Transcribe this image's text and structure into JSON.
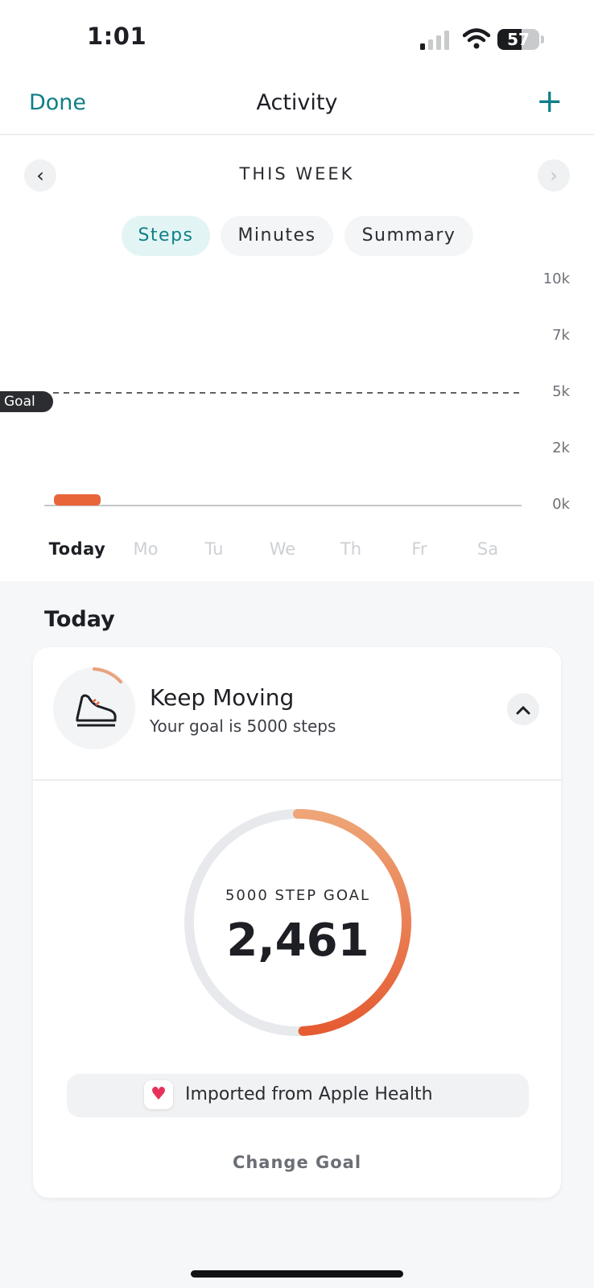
{
  "status_bar": {
    "time": "1:01",
    "battery_level": "57",
    "battery_fraction": 0.57
  },
  "nav": {
    "done_label": "Done",
    "title": "Activity",
    "add_icon": "plus-icon",
    "accent_color": "#0e7f87"
  },
  "week": {
    "label": "THIS WEEK",
    "prev_icon": "chevron-left-icon",
    "next_icon": "chevron-right-icon"
  },
  "tabs": [
    {
      "label": "Steps",
      "active": true
    },
    {
      "label": "Minutes",
      "active": false
    },
    {
      "label": "Summary",
      "active": false
    }
  ],
  "chart_data": {
    "type": "bar",
    "categories": [
      "Today",
      "Mo",
      "Tu",
      "We",
      "Th",
      "Fr",
      "Sa"
    ],
    "values": [
      2461,
      0,
      0,
      0,
      0,
      0,
      0
    ],
    "y_ticks": [
      "10k",
      "7k",
      "5k",
      "2k",
      "0k"
    ],
    "ylim": [
      0,
      10000
    ],
    "goal_line": {
      "label": "Goal",
      "value": 5000
    },
    "bar_color": "#e8653a",
    "grid": false
  },
  "today": {
    "heading": "Today",
    "card": {
      "icon": "shoe-icon",
      "title": "Keep Moving",
      "subtitle": "Your goal is 5000 steps",
      "collapse_icon": "chevron-up-icon",
      "ring_label": "5000 STEP GOAL",
      "ring_value": "2,461",
      "progress_fraction": 0.4922,
      "import_icon": "heart-icon",
      "import_text": "Imported from Apple Health",
      "change_goal_label": "Change Goal"
    }
  }
}
